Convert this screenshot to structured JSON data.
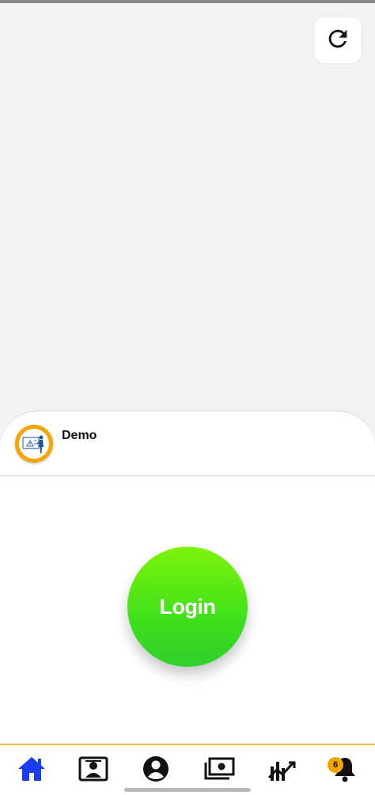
{
  "header": {
    "refresh_icon": "refresh-icon"
  },
  "account": {
    "name": "Demo",
    "avatar_icon": "support-agent-icon"
  },
  "login": {
    "label": "Login",
    "color": "#4ee61a"
  },
  "bottom_nav": {
    "accent_color": "#f0c24a",
    "active_color": "#1a3df0",
    "items": [
      {
        "icon": "home-icon",
        "active": true
      },
      {
        "icon": "contact-card-icon",
        "active": false
      },
      {
        "icon": "account-circle-icon",
        "active": false
      },
      {
        "icon": "money-icon",
        "active": false
      },
      {
        "icon": "trend-chart-icon",
        "active": false
      },
      {
        "icon": "bell-icon",
        "active": false,
        "badge": "6"
      }
    ]
  }
}
